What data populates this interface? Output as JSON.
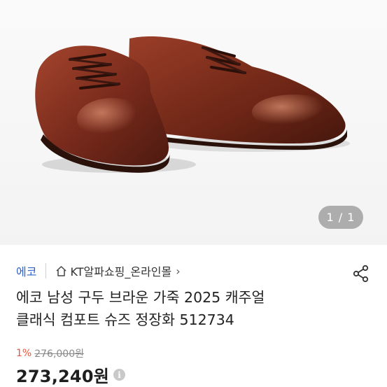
{
  "gallery": {
    "image_alt_icon": "brown-leather-derby-shoes",
    "counter": "1 / 1"
  },
  "product": {
    "brand": "에코",
    "store": "KT알파쇼핑_온라인몰",
    "title": "에코 남성 구두 브라운 가죽 2025 캐주얼\n클래식 컴포트 슈즈 정장화 512734",
    "discount": "1%",
    "original_price": "276,000원",
    "price": "273,240원"
  },
  "colors": {
    "brand_link": "#2f63c7",
    "discount": "#e8553a",
    "shoe_leather": "#7a2b1c"
  },
  "icons": {
    "home": "home-icon",
    "chevron": "chevron-right-icon",
    "share": "share-icon",
    "info": "info-icon"
  }
}
